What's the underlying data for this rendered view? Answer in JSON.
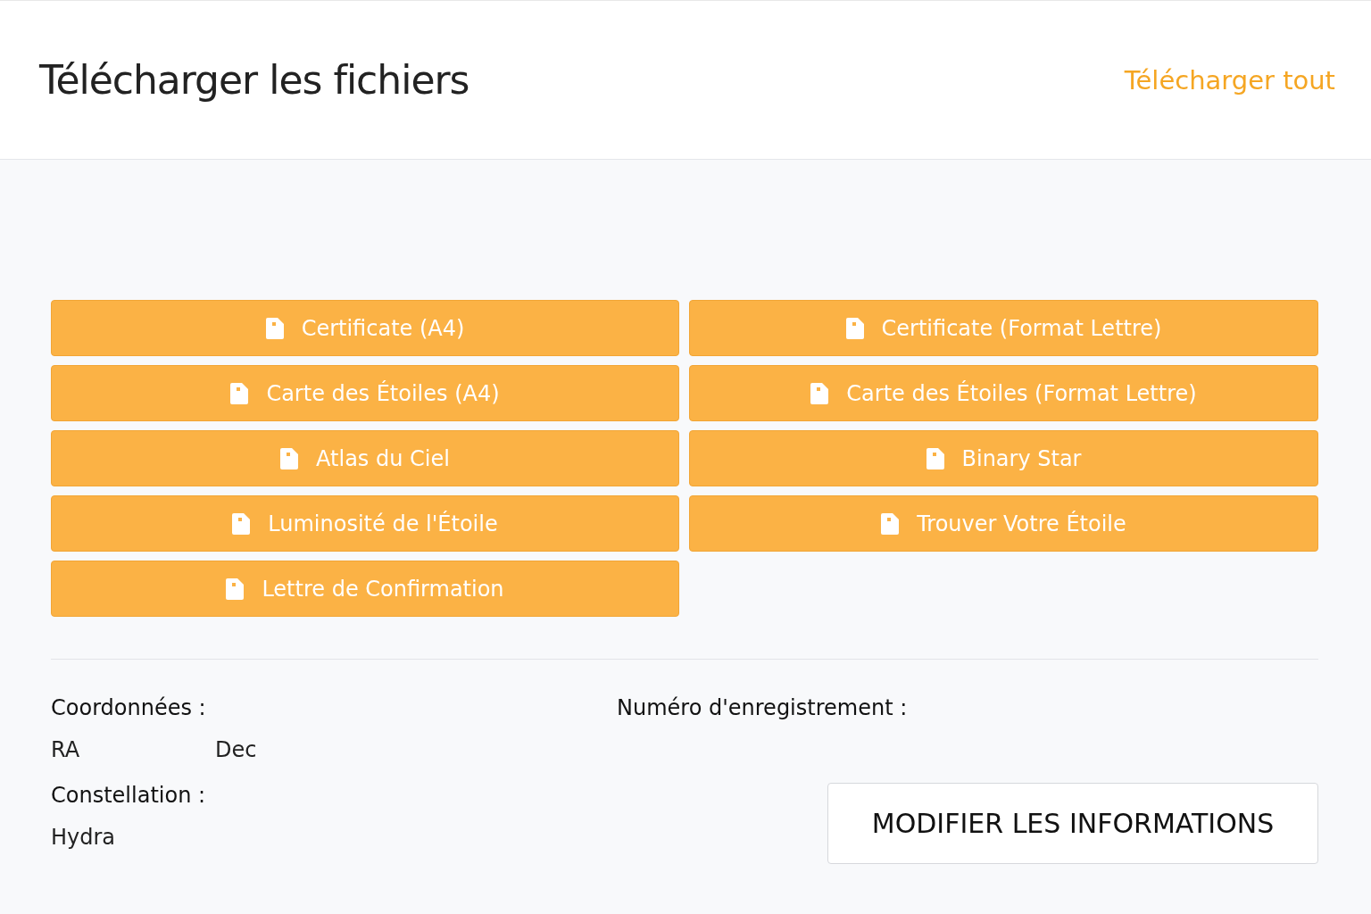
{
  "header": {
    "title": "Télécharger les fichiers",
    "download_all": "Télécharger tout"
  },
  "files": [
    {
      "label": "Certificate (A4)"
    },
    {
      "label": "Certificate (Format Lettre)"
    },
    {
      "label": "Carte des Étoiles (A4)"
    },
    {
      "label": "Carte des Étoiles (Format Lettre)"
    },
    {
      "label": "Atlas du Ciel"
    },
    {
      "label": "Binary Star"
    },
    {
      "label": "Luminosité de l'Étoile"
    },
    {
      "label": "Trouver Votre Étoile"
    },
    {
      "label": "Lettre de Confirmation"
    }
  ],
  "details": {
    "coordinates_label": "Coordonnées :",
    "ra_label": "RA",
    "dec_label": "Dec",
    "registration_label": "Numéro d'enregistrement :",
    "constellation_label": "Constellation :",
    "constellation_value": "Hydra"
  },
  "edit_button": "MODIFIER LES INFORMATIONS"
}
